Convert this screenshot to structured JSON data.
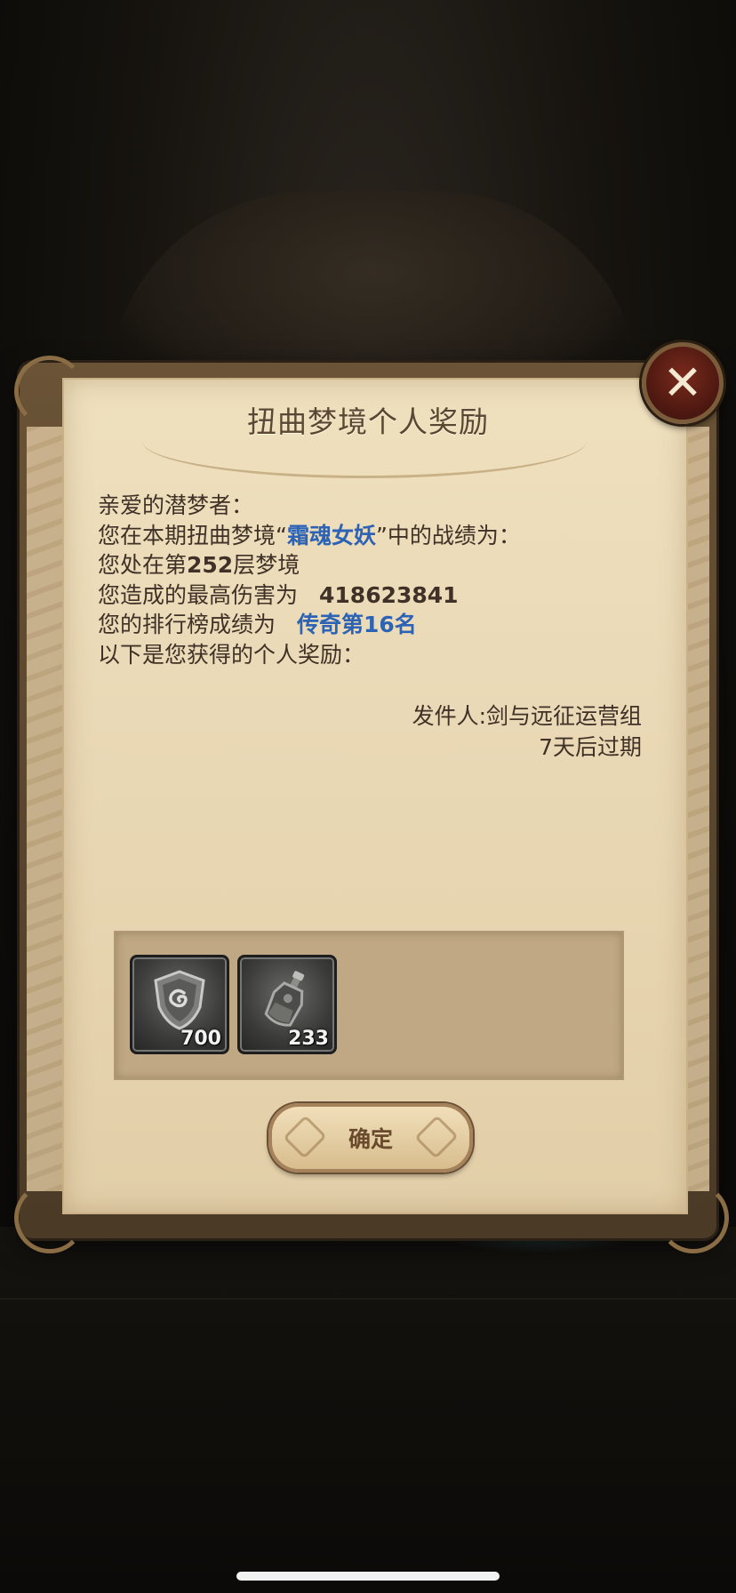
{
  "dialog": {
    "title": "扭曲梦境个人奖励",
    "greeting": "亲爱的潜梦者：",
    "line2_prefix": "您在本期扭曲梦境“",
    "line2_boss": "霜魂女妖",
    "line2_suffix": "”中的战绩为：",
    "line3_prefix": "您处在第",
    "line3_floor": "252",
    "line3_suffix": "层梦境",
    "line4_label": "您造成的最高伤害为",
    "line4_value": "418623841",
    "line5_label": "您的排行榜成绩为",
    "line5_value": "传奇第16名",
    "line6": "以下是您获得的个人奖励：",
    "sender": "发件人:剑与远征运营组",
    "expiry": "7天后过期",
    "close_icon": "close-icon"
  },
  "rewards": [
    {
      "icon": "shield-emblem-icon",
      "count": "700"
    },
    {
      "icon": "potion-bottle-icon",
      "count": "233"
    }
  ],
  "confirm_label": "确定"
}
